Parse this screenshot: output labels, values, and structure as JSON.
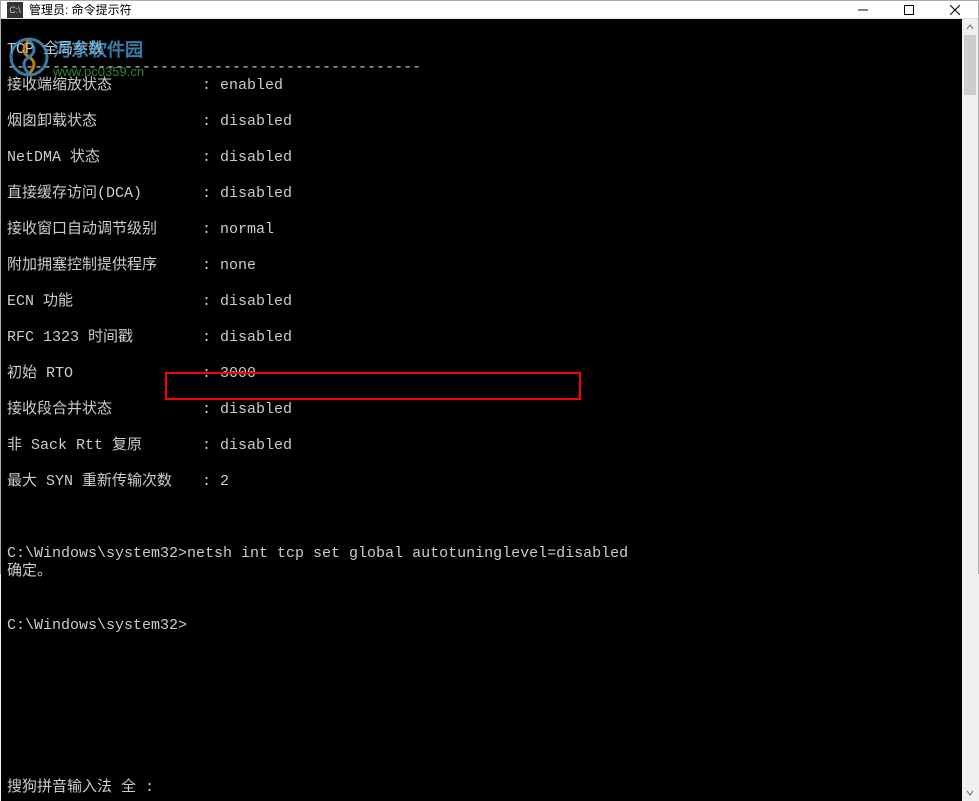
{
  "titlebar": {
    "icon_label": "CMD",
    "title": "管理员: 命令提示符"
  },
  "watermark": {
    "site_name": "河东软件园",
    "site_url": "www.pc0359.cn"
  },
  "console": {
    "header": "TCP 全局参数",
    "dashes": "----------------------------------------------",
    "params": [
      {
        "label": "接收端缩放状态",
        "value": "enabled"
      },
      {
        "label": "烟囱卸载状态",
        "value": "disabled"
      },
      {
        "label": "NetDMA 状态",
        "value": "disabled"
      },
      {
        "label": "直接缓存访问(DCA)",
        "value": "disabled"
      },
      {
        "label": "接收窗口自动调节级别",
        "value": "normal"
      },
      {
        "label": "附加拥塞控制提供程序",
        "value": "none"
      },
      {
        "label": "ECN 功能",
        "value": "disabled"
      },
      {
        "label": "RFC 1323 时间戳",
        "value": "disabled"
      },
      {
        "label": "初始 RTO",
        "value": "3000"
      },
      {
        "label": "接收段合并状态",
        "value": "disabled"
      },
      {
        "label": "非 Sack Rtt 复原",
        "value": "disabled"
      },
      {
        "label": "最大 SYN 重新传输次数",
        "value": "2"
      }
    ],
    "prompt1_path": "C:\\Windows\\system32>",
    "prompt1_cmd": "netsh int tcp set global autotuninglevel=disabled",
    "result1": "确定。",
    "prompt2_path": "C:\\Windows\\system32>",
    "ime_status": "搜狗拼音输入法 全 :"
  }
}
